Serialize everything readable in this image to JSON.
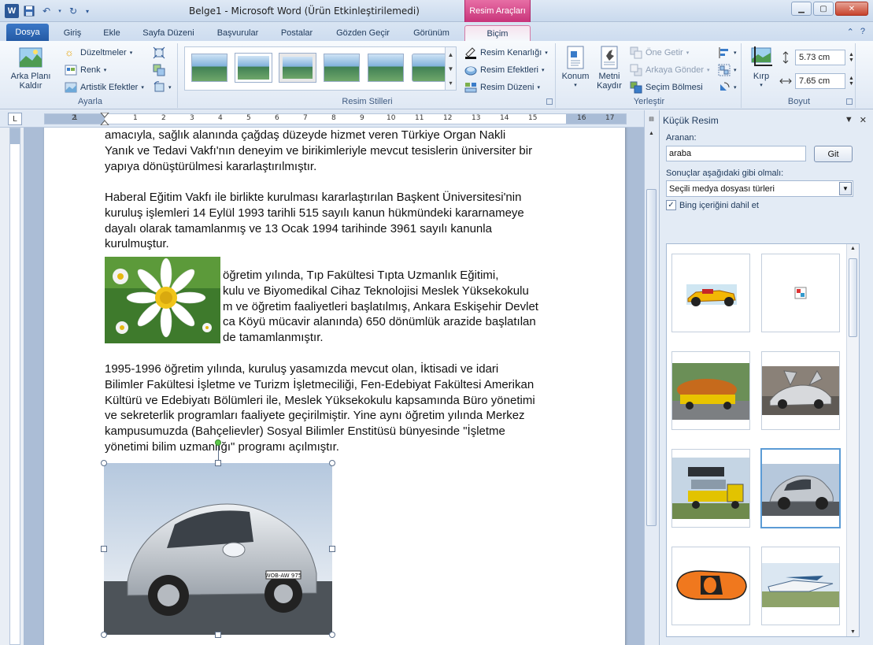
{
  "window": {
    "title": "Belge1  -  Microsoft Word (Ürün Etkinleştirilemedi)",
    "context_tab_group": "Resim Araçları"
  },
  "tabs": [
    {
      "label": "Dosya"
    },
    {
      "label": "Giriş"
    },
    {
      "label": "Ekle"
    },
    {
      "label": "Sayfa Düzeni"
    },
    {
      "label": "Başvurular"
    },
    {
      "label": "Postalar"
    },
    {
      "label": "Gözden Geçir"
    },
    {
      "label": "Görünüm"
    },
    {
      "label": "Biçim"
    }
  ],
  "ribbon": {
    "ayarla": {
      "label": "Ayarla",
      "remove_bg_line1": "Arka Planı",
      "remove_bg_line2": "Kaldır",
      "corrections": "Düzeltmeler",
      "color": "Renk",
      "artistic": "Artistik Efektler"
    },
    "styles": {
      "label": "Resim Stilleri",
      "border": "Resim Kenarlığı",
      "effects": "Resim Efektleri",
      "layout": "Resim Düzeni"
    },
    "arrange": {
      "label": "Yerleştir",
      "position": "Konum",
      "wrap_line1": "Metni",
      "wrap_line2": "Kaydır",
      "bring_forward": "Öne Getir",
      "send_backward": "Arkaya Gönder",
      "selection_pane": "Seçim Bölmesi"
    },
    "size": {
      "label": "Boyut",
      "crop": "Kırp",
      "height": "5.73 cm",
      "width": "7.65 cm"
    }
  },
  "ruler": {
    "numbers": [
      "2",
      "1",
      "1",
      "2",
      "3",
      "4",
      "5",
      "6",
      "7",
      "8",
      "9",
      "10",
      "11",
      "12",
      "13",
      "14",
      "15",
      "16",
      "17"
    ]
  },
  "document": {
    "para1": "amacıyla, sağlık alanında çağdaş düzeyde hizmet veren Türkiye Organ Nakli\nYanık ve Tedavi Vakfı'nın deneyim ve birikimleriyle mevcut tesislerin üniversiter bir\nyapıya dönüştürülmesi kararlaştırılmıştır.",
    "para2": "Haberal Eğitim Vakfı ile birlikte kurulması kararlaştırılan Başkent Üniversitesi'nin\nkuruluş işlemleri 14 Eylül 1993 tarihli 515 sayılı kanun hükmündeki kararnameye\ndayalı olarak tamamlanmış ve 13 Ocak 1994 tarihinde 3961 sayılı kanunla\nkurulmuştur.",
    "para3": "öğretim yılında, Tıp Fakültesi Tıpta Uzmanlık Eğitimi,\nkulu ve Biyomedikal Cihaz Teknolojisi Meslek Yüksekokulu\nm ve öğretim faaliyetleri başlatılmış, Ankara Eskişehir Devlet\nca Köyü mücavir alanında) 650 dönümlük arazide başlatılan\nde tamamlanmıştır.",
    "para4": "1995-1996 öğretim yılında, kuruluş yasamızda mevcut olan, İktisadi ve idari\nBilimler Fakültesi İşletme ve Turizm İşletmeciliği, Fen-Edebiyat Fakültesi Amerikan\nKültürü ve Edebiyatı Bölümleri ile, Meslek Yüksekokulu kapsamında Büro yönetimi\nve sekreterlik programları faaliyete geçirilmiştir. Yine aynı öğretim yılında Merkez\nkampusumuzda (Bahçelievler) Sosyal Bilimler Enstitüsü bünyesinde \"İşletme\nyönetimi bilim uzmanlığı\" programı açılmıştır.",
    "car_plate": "WOB-AW 975"
  },
  "pane": {
    "title": "Küçük Resim",
    "search_label": "Aranan:",
    "search_value": "araba",
    "go_label": "Git",
    "results_label": "Sonuçlar aşağıdaki gibi olmalı:",
    "results_select": "Seçili medya dosyası türleri",
    "bing_label": "Bing içeriğini dahil et"
  },
  "colors": {
    "file_tab": "#2b5797",
    "context_tab": "#c8347a",
    "selection": "#5b9bd5"
  }
}
